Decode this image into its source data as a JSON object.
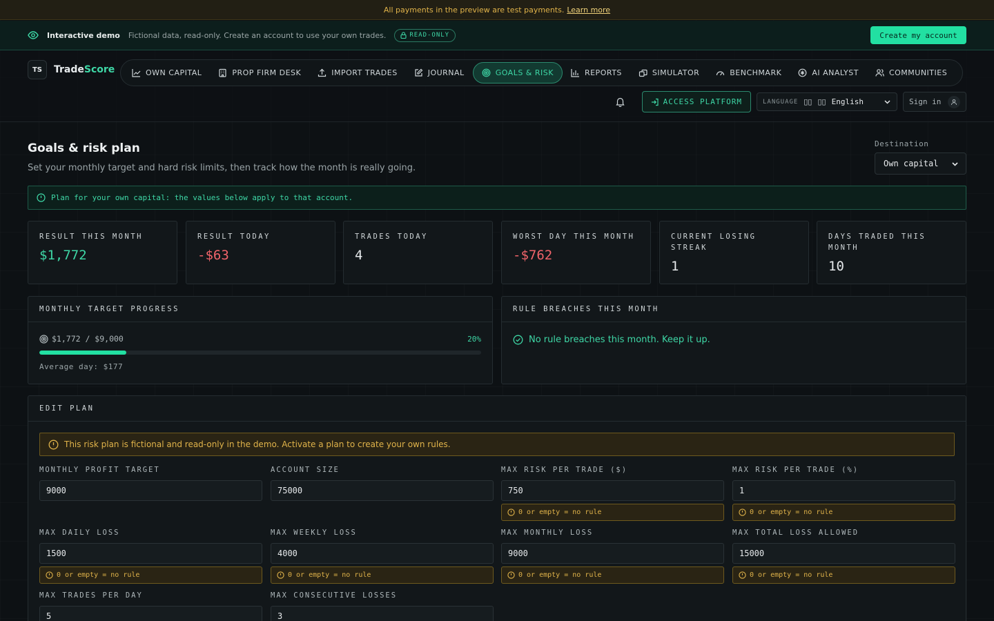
{
  "test_banner": {
    "text": "All payments in the preview are test payments.",
    "link": "Learn more"
  },
  "demo_bar": {
    "title": "Interactive demo",
    "description": "Fictional data, read-only. Create an account to use your own trades.",
    "badge": "READ-ONLY",
    "cta": "Create my account"
  },
  "brand": {
    "mark": "TS",
    "name_a": "Trade",
    "name_b": "Score"
  },
  "nav": {
    "items": [
      {
        "label": "OWN CAPITAL",
        "icon": "chart-line-icon"
      },
      {
        "label": "PROP FIRM DESK",
        "icon": "building-icon"
      },
      {
        "label": "IMPORT TRADES",
        "icon": "upload-icon"
      },
      {
        "label": "JOURNAL",
        "icon": "pencil-square-icon"
      },
      {
        "label": "GOALS & RISK",
        "icon": "target-icon",
        "active": true
      },
      {
        "label": "REPORTS",
        "icon": "bar-chart-icon"
      },
      {
        "label": "SIMULATOR",
        "icon": "simulator-icon"
      },
      {
        "label": "BENCHMARK",
        "icon": "gauge-icon"
      },
      {
        "label": "AI ANALYST",
        "icon": "ai-icon"
      },
      {
        "label": "COMMUNITIES",
        "icon": "users-icon"
      }
    ]
  },
  "header_right": {
    "access": "ACCESS PLATFORM",
    "language_label": "LANGUAGE",
    "language_glyph": "▯▯",
    "language_flag": "▯▯",
    "language_value": "English",
    "signin": "Sign in"
  },
  "page": {
    "title": "Goals & risk plan",
    "subtitle": "Set your monthly target and hard risk limits, then track how the month is really going.",
    "destination_label": "Destination",
    "destination_value": "Own capital",
    "info": "Plan for your own capital: the values below apply to that account."
  },
  "stats": [
    {
      "label": "RESULT THIS MONTH",
      "value": "$1,772",
      "tone": "green"
    },
    {
      "label": "RESULT TODAY",
      "value": "-$63",
      "tone": "red"
    },
    {
      "label": "TRADES TODAY",
      "value": "4",
      "tone": "neutral"
    },
    {
      "label": "WORST DAY THIS MONTH",
      "value": "-$762",
      "tone": "red"
    },
    {
      "label": "CURRENT LOSING STREAK",
      "value": "1",
      "tone": "neutral"
    },
    {
      "label": "DAYS TRADED THIS MONTH",
      "value": "10",
      "tone": "neutral"
    }
  ],
  "target_progress": {
    "title": "MONTHLY TARGET PROGRESS",
    "amount": "$1,772 / $9,000",
    "percent_label": "20%",
    "fraction": 0.197,
    "average": "Average day: $177"
  },
  "breaches": {
    "title": "RULE BREACHES THIS MONTH",
    "message": "No rule breaches this month. Keep it up."
  },
  "edit_plan": {
    "title": "EDIT PLAN",
    "warning": "This risk plan is fictional and read-only in the demo. Activate a plan to create your own rules.",
    "hint": "0 or empty = no rule",
    "fields": [
      {
        "label": "MONTHLY PROFIT TARGET",
        "value": "9000",
        "hint": false
      },
      {
        "label": "ACCOUNT SIZE",
        "value": "75000",
        "hint": false
      },
      {
        "label": "MAX RISK PER TRADE ($)",
        "value": "750",
        "hint": true
      },
      {
        "label": "MAX RISK PER TRADE (%)",
        "value": "1",
        "hint": true
      },
      {
        "label": "MAX DAILY LOSS",
        "value": "1500",
        "hint": true
      },
      {
        "label": "MAX WEEKLY LOSS",
        "value": "4000",
        "hint": true
      },
      {
        "label": "MAX MONTHLY LOSS",
        "value": "9000",
        "hint": true
      },
      {
        "label": "MAX TOTAL LOSS ALLOWED",
        "value": "15000",
        "hint": true
      },
      {
        "label": "MAX TRADES PER DAY",
        "value": "5",
        "hint": false
      },
      {
        "label": "MAX CONSECUTIVE LOSSES",
        "value": "3",
        "hint": false
      }
    ]
  },
  "colors": {
    "accent": "#22e0a2",
    "accent_text": "#3ed7a6",
    "negative": "#f0646a",
    "warning": "#e0b34a"
  }
}
